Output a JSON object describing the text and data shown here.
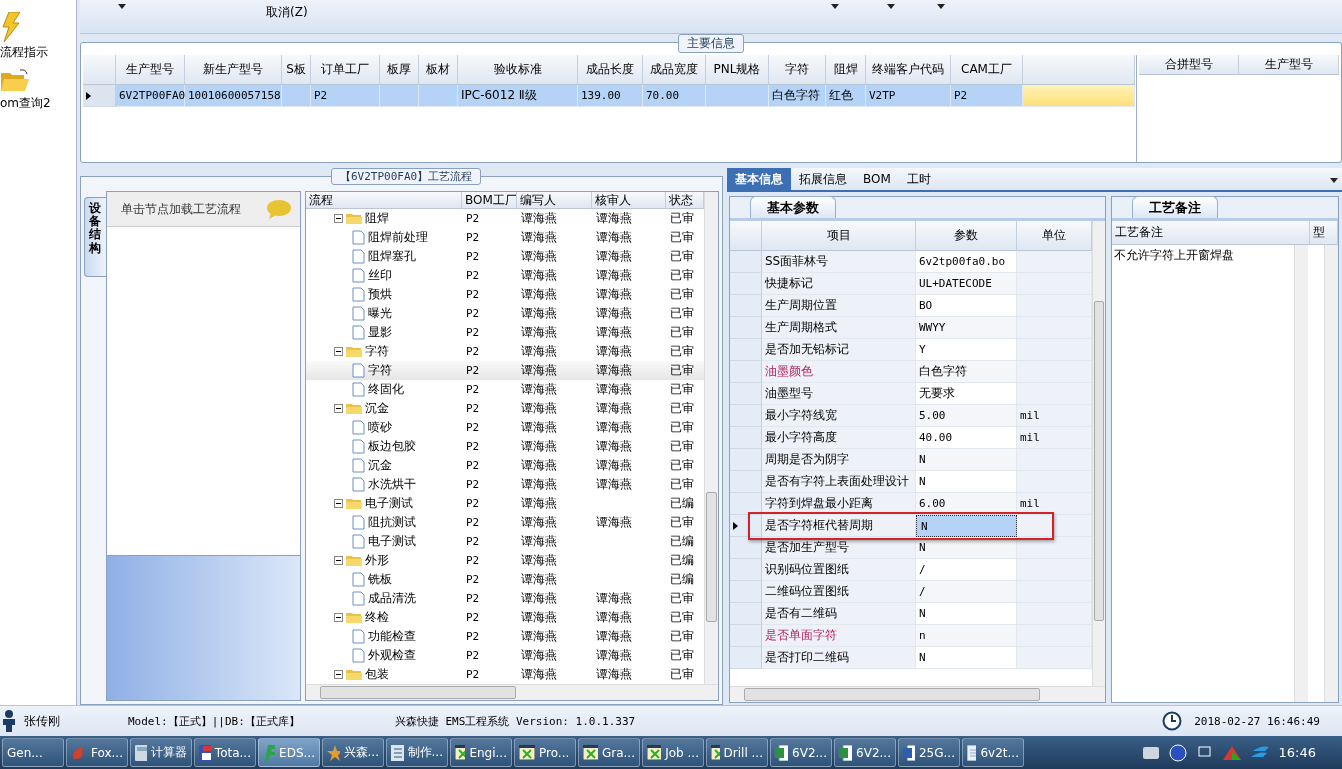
{
  "sidebar": {
    "items": [
      {
        "label": "流程指示",
        "kind": "bolt"
      },
      {
        "label": "om查询2",
        "kind": "folder"
      }
    ]
  },
  "toolbar": {
    "items": [
      {
        "label": "取消(Z)"
      }
    ]
  },
  "main_info": {
    "title": "主要信息",
    "columns": [
      "生产型号",
      "新生产型号",
      "S板",
      "订单工厂",
      "板厚",
      "板材",
      "验收标准",
      "成品长度",
      "成品宽度",
      "PNL规格",
      "字符",
      "阻焊",
      "终端客户代码",
      "CAM工厂"
    ],
    "rows": [
      {
        "selected": true,
        "cells": [
          "6V2TP00FA0",
          "10010600057158",
          "",
          "P2",
          "",
          "",
          "IPC-6012 Ⅱ级",
          "139.00",
          "70.00",
          "",
          "白色字符",
          "红色",
          "V2TP",
          "P2"
        ]
      }
    ],
    "merge_columns": [
      "合拼型号",
      "生产型号"
    ]
  },
  "process": {
    "title": "【6V2TP00FA0】工艺流程",
    "side_tab": "设备结构",
    "hint": "单击节点加载工艺流程",
    "columns": [
      "流程",
      "BOM工厂",
      "编写人",
      "核审人",
      "状态"
    ],
    "tree": [
      {
        "name": "阻焊",
        "factory": "P2",
        "writer": "谭海燕",
        "reviewer": "谭海燕",
        "status": "已审",
        "selected": false,
        "expanded": true,
        "children": [
          {
            "name": "阻焊前处理",
            "factory": "P2",
            "writer": "谭海燕",
            "reviewer": "谭海燕",
            "status": "已审",
            "selected": false
          },
          {
            "name": "阻焊塞孔",
            "factory": "P2",
            "writer": "谭海燕",
            "reviewer": "谭海燕",
            "status": "已审",
            "selected": false
          },
          {
            "name": "丝印",
            "factory": "P2",
            "writer": "谭海燕",
            "reviewer": "谭海燕",
            "status": "已审",
            "selected": false
          },
          {
            "name": "预烘",
            "factory": "P2",
            "writer": "谭海燕",
            "reviewer": "谭海燕",
            "status": "已审",
            "selected": false
          },
          {
            "name": "曝光",
            "factory": "P2",
            "writer": "谭海燕",
            "reviewer": "谭海燕",
            "status": "已审",
            "selected": false
          },
          {
            "name": "显影",
            "factory": "P2",
            "writer": "谭海燕",
            "reviewer": "谭海燕",
            "status": "已审",
            "selected": false
          }
        ]
      },
      {
        "name": "字符",
        "factory": "P2",
        "writer": "谭海燕",
        "reviewer": "谭海燕",
        "status": "已审",
        "selected": false,
        "expanded": true,
        "children": [
          {
            "name": "字符",
            "factory": "P2",
            "writer": "谭海燕",
            "reviewer": "谭海燕",
            "status": "已审",
            "selected": true
          },
          {
            "name": "终固化",
            "factory": "P2",
            "writer": "谭海燕",
            "reviewer": "谭海燕",
            "status": "已审",
            "selected": false
          }
        ]
      },
      {
        "name": "沉金",
        "factory": "P2",
        "writer": "谭海燕",
        "reviewer": "谭海燕",
        "status": "已审",
        "selected": false,
        "expanded": true,
        "children": [
          {
            "name": "喷砂",
            "factory": "P2",
            "writer": "谭海燕",
            "reviewer": "谭海燕",
            "status": "已审",
            "selected": false
          },
          {
            "name": "板边包胶",
            "factory": "P2",
            "writer": "谭海燕",
            "reviewer": "谭海燕",
            "status": "已审",
            "selected": false
          },
          {
            "name": "沉金",
            "factory": "P2",
            "writer": "谭海燕",
            "reviewer": "谭海燕",
            "status": "已审",
            "selected": false
          },
          {
            "name": "水洗烘干",
            "factory": "P2",
            "writer": "谭海燕",
            "reviewer": "谭海燕",
            "status": "已审",
            "selected": false
          }
        ]
      },
      {
        "name": "电子测试",
        "factory": "P2",
        "writer": "谭海燕",
        "status": "已编",
        "selected": false,
        "expanded": true,
        "children": [
          {
            "name": "阻抗测试",
            "factory": "P2",
            "writer": "谭海燕",
            "reviewer": "谭海燕",
            "status": "已审",
            "selected": false
          },
          {
            "name": "电子测试",
            "factory": "P2",
            "writer": "谭海燕",
            "status": "已编",
            "selected": false
          }
        ]
      },
      {
        "name": "外形",
        "factory": "P2",
        "writer": "谭海燕",
        "status": "已编",
        "selected": false,
        "expanded": true,
        "children": [
          {
            "name": "铣板",
            "factory": "P2",
            "writer": "谭海燕",
            "status": "已编",
            "selected": false
          },
          {
            "name": "成品清洗",
            "factory": "P2",
            "writer": "谭海燕",
            "reviewer": "谭海燕",
            "status": "已审",
            "selected": false
          }
        ]
      },
      {
        "name": "终检",
        "factory": "P2",
        "writer": "谭海燕",
        "reviewer": "谭海燕",
        "status": "已审",
        "selected": false,
        "expanded": true,
        "children": [
          {
            "name": "功能检查",
            "factory": "P2",
            "writer": "谭海燕",
            "reviewer": "谭海燕",
            "status": "已审",
            "selected": false
          },
          {
            "name": "外观检查",
            "factory": "P2",
            "writer": "谭海燕",
            "reviewer": "谭海燕",
            "status": "已审",
            "selected": false
          }
        ]
      },
      {
        "name": "包装",
        "factory": "P2",
        "writer": "谭海燕",
        "reviewer": "谭海燕",
        "status": "已审",
        "selected": false,
        "expanded": true
      }
    ]
  },
  "detail": {
    "tabs": [
      {
        "label": "基本信息",
        "selected": true
      },
      {
        "label": "拓展信息",
        "selected": false
      },
      {
        "label": "BOM",
        "selected": false
      },
      {
        "label": "工时",
        "selected": false
      }
    ],
    "subtab": "基本参数",
    "columns": [
      "项目",
      "参数",
      "单位"
    ],
    "rows": [
      {
        "item": "SS面菲林号",
        "value": "6v2tp00fa0.bo",
        "unit": "",
        "highlighted": false,
        "selected": false,
        "marked": false
      },
      {
        "item": "快捷标记",
        "value": "UL+DATECODE",
        "unit": "",
        "highlighted": false,
        "selected": false,
        "marked": false
      },
      {
        "item": "生产周期位置",
        "value": "BO",
        "unit": "",
        "highlighted": false,
        "selected": false,
        "marked": false
      },
      {
        "item": "生产周期格式",
        "value": "WWYY",
        "unit": "",
        "highlighted": false,
        "selected": false,
        "marked": false
      },
      {
        "item": "是否加无铅标记",
        "value": "Y",
        "unit": "",
        "highlighted": false,
        "selected": false,
        "marked": false
      },
      {
        "item": "油墨颜色",
        "value": "白色字符",
        "unit": "",
        "highlighted": true,
        "selected": false,
        "marked": false
      },
      {
        "item": "油墨型号",
        "value": "无要求",
        "unit": "",
        "highlighted": false,
        "selected": false,
        "marked": false
      },
      {
        "item": "最小字符线宽",
        "value": "5.00",
        "unit": "mil",
        "highlighted": false,
        "selected": false,
        "marked": false
      },
      {
        "item": "最小字符高度",
        "value": "40.00",
        "unit": "mil",
        "highlighted": false,
        "selected": false,
        "marked": false
      },
      {
        "item": "周期是否为阴字",
        "value": "N",
        "unit": "",
        "highlighted": false,
        "selected": false,
        "marked": false
      },
      {
        "item": "是否有字符上表面处理设计",
        "value": "N",
        "unit": "",
        "highlighted": false,
        "selected": false,
        "marked": false
      },
      {
        "item": "字符到焊盘最小距离",
        "value": "6.00",
        "unit": "mil",
        "highlighted": false,
        "selected": false,
        "marked": false
      },
      {
        "item": "是否字符框代替周期",
        "value": "N",
        "unit": "",
        "highlighted": false,
        "selected": true,
        "marked": true
      },
      {
        "item": "是否加生产型号",
        "value": "N",
        "unit": "",
        "highlighted": false,
        "selected": false,
        "marked": false
      },
      {
        "item": "识别码位置图纸",
        "value": "/",
        "unit": "",
        "highlighted": false,
        "selected": false,
        "marked": false
      },
      {
        "item": "二维码位置图纸",
        "value": "/",
        "unit": "",
        "highlighted": false,
        "selected": false,
        "marked": false
      },
      {
        "item": "是否有二维码",
        "value": "N",
        "unit": "",
        "highlighted": false,
        "selected": false,
        "marked": false
      },
      {
        "item": "是否单面字符",
        "value": "n",
        "unit": "",
        "highlighted": true,
        "selected": false,
        "marked": false
      },
      {
        "item": "是否打印二维码",
        "value": "N",
        "unit": "",
        "highlighted": false,
        "selected": false,
        "marked": false
      }
    ]
  },
  "notes": {
    "title": "工艺备注",
    "columns": [
      "工艺备注",
      "型"
    ],
    "rows": [
      "不允许字符上开窗焊盘"
    ]
  },
  "status_bar": {
    "user": "张传刚",
    "model": "Model:【正式】||DB:【正式库】",
    "app": "兴森快捷 EMS工程系统 Version: 1.0.1.337",
    "datetime": "2018-02-27 16:46:49"
  },
  "taskbar": {
    "items": [
      {
        "label": "Gen...",
        "kind": "blank",
        "selected": false
      },
      {
        "label": "Fox...",
        "kind": "fox",
        "selected": false
      },
      {
        "label": "计算器",
        "kind": "calc",
        "selected": false
      },
      {
        "label": "Tota...",
        "kind": "disk",
        "selected": false
      },
      {
        "label": "EDS...",
        "kind": "eds",
        "selected": true
      },
      {
        "label": "兴森...",
        "kind": "star",
        "selected": false
      },
      {
        "label": "制作...",
        "kind": "list",
        "selected": false
      },
      {
        "label": "Engi...",
        "kind": "window",
        "selected": false
      },
      {
        "label": "Pro...",
        "kind": "window",
        "selected": false
      },
      {
        "label": "Gra...",
        "kind": "window",
        "selected": false
      },
      {
        "label": "Job ...",
        "kind": "window",
        "selected": false
      },
      {
        "label": "Drill ...",
        "kind": "window",
        "selected": false
      },
      {
        "label": "6V2...",
        "kind": "excel",
        "selected": false
      },
      {
        "label": "6V2...",
        "kind": "excel",
        "selected": false
      },
      {
        "label": "25G...",
        "kind": "word",
        "selected": false
      },
      {
        "label": "6v2t...",
        "kind": "note",
        "selected": false
      }
    ],
    "clock": "16:46"
  }
}
